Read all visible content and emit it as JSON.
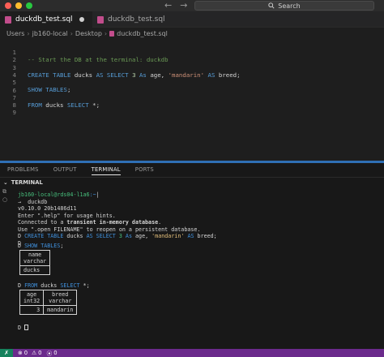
{
  "window": {
    "nav_back": "←",
    "nav_forward": "→",
    "search_label": "Search",
    "traffic_colors": [
      "#ff5f57",
      "#febc2e",
      "#28c840"
    ]
  },
  "tabs": [
    {
      "label": "duckdb_test.sql",
      "active": true,
      "modified": true
    },
    {
      "label": "duckdb_test.sql",
      "active": false
    }
  ],
  "breadcrumb": [
    "Users",
    "jb160-local",
    "Desktop",
    "duckdb_test.sql"
  ],
  "editor": {
    "line_numbers": [
      "1",
      "2",
      "3",
      "4",
      "5",
      "6",
      "7",
      "8",
      "9"
    ],
    "line1": "-- Start the DB at the terminal: duckdb",
    "line3": {
      "t1": "CREATE TABLE",
      "t2": " ducks ",
      "t3": "AS SELECT",
      "t4": " ",
      "t5": "3",
      "t6": " ",
      "t7": "As",
      "t8": " age, ",
      "t9": "'mandarin'",
      "t10": " ",
      "t11": "AS",
      "t12": " breed;"
    },
    "line5": {
      "t1": "SHOW TABLES",
      "t2": ";"
    },
    "line7": {
      "t1": "FROM",
      "t2": " ducks ",
      "t3": "SELECT",
      "t4": " *;"
    }
  },
  "panel": {
    "tabs": [
      "PROBLEMS",
      "OUTPUT",
      "TERMINAL",
      "PORTS"
    ],
    "active_tab": "TERMINAL",
    "section_title": "TERMINAL"
  },
  "terminal": {
    "prompt_user": "jb160-local",
    "prompt_host": "@rds04-l1a6",
    "prompt_path": ":~",
    "prompt_end": "|",
    "cmd_line": "→  duckdb",
    "version": "v0.10.0 20b1486d11",
    "help": "Enter \".help\" for usage hints.",
    "conn1": "Connected to a ",
    "conn2": "transient in-memory database",
    "conn3": ".",
    "reopen": "Use \".open FILENAME\" to reopen on a persistent database.",
    "q1": {
      "t1": "D ",
      "t2": "CREATE TABLE",
      "t3": " ducks ",
      "t4": "AS SELECT",
      "t5": " ",
      "t6": "3",
      "t7": " ",
      "t8": "As",
      "t9": " age, ",
      "t10": "'mandarin'",
      "t11": " ",
      "t12": "AS",
      "t13": " breed;"
    },
    "d_only": "D",
    "q2": {
      "t1": "D ",
      "t2": "SHOW TABLES",
      "t3": ";"
    },
    "table1": {
      "header_name": "name",
      "header_type": "varchar",
      "row": "ducks"
    },
    "q3": {
      "t1": "D ",
      "t2": "FROM",
      "t3": " ducks ",
      "t4": "SELECT",
      "t5": " *;"
    },
    "table2": {
      "headers": [
        "age",
        "breed"
      ],
      "types": [
        "int32",
        "varchar"
      ],
      "row": [
        "3",
        "mandarin"
      ]
    },
    "final_prompt": "D "
  },
  "status": {
    "remote": "✗",
    "errors": "0",
    "warnings": "0",
    "ports": "0"
  }
}
